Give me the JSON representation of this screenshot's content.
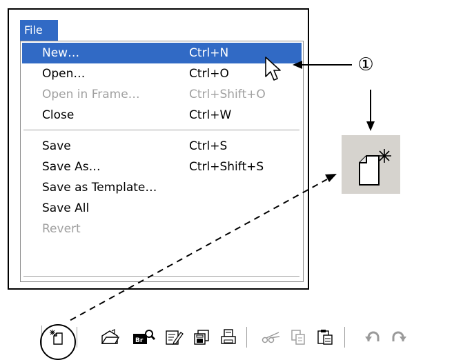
{
  "menu": {
    "title": "File",
    "items": [
      {
        "label": "New…",
        "shortcut": "Ctrl+N",
        "state": "selected"
      },
      {
        "label": "Open…",
        "shortcut": "Ctrl+O",
        "state": "normal"
      },
      {
        "label": "Open in Frame…",
        "shortcut": "Ctrl+Shift+O",
        "state": "disabled"
      },
      {
        "label": "Close",
        "shortcut": "Ctrl+W",
        "state": "normal"
      },
      {
        "label": "Save",
        "shortcut": "Ctrl+S",
        "state": "normal"
      },
      {
        "label": "Save As…",
        "shortcut": "Ctrl+Shift+S",
        "state": "normal"
      },
      {
        "label": "Save as Template…",
        "shortcut": "",
        "state": "normal"
      },
      {
        "label": "Save All",
        "shortcut": "",
        "state": "normal"
      },
      {
        "label": "Revert",
        "shortcut": "",
        "state": "disabled"
      }
    ]
  },
  "annotation": {
    "step_marker": "①"
  },
  "toolbar": {
    "buttons": [
      {
        "icon": "new-document-icon"
      },
      {
        "icon": "open-folder-icon"
      },
      {
        "icon": "browse-in-bridge-icon"
      },
      {
        "icon": "edit-document-icon"
      },
      {
        "icon": "save-all-icon"
      },
      {
        "icon": "print-icon"
      },
      {
        "icon": "cut-icon",
        "state": "disabled"
      },
      {
        "icon": "copy-icon",
        "state": "disabled"
      },
      {
        "icon": "paste-icon"
      },
      {
        "icon": "undo-icon",
        "state": "disabled"
      },
      {
        "icon": "redo-icon",
        "state": "disabled"
      }
    ],
    "bridge_badge": "Br"
  },
  "colors": {
    "selection": "#316ac5",
    "disabled_text": "#a0a0a0",
    "toolbar_button_bg": "#d6d3ce"
  }
}
